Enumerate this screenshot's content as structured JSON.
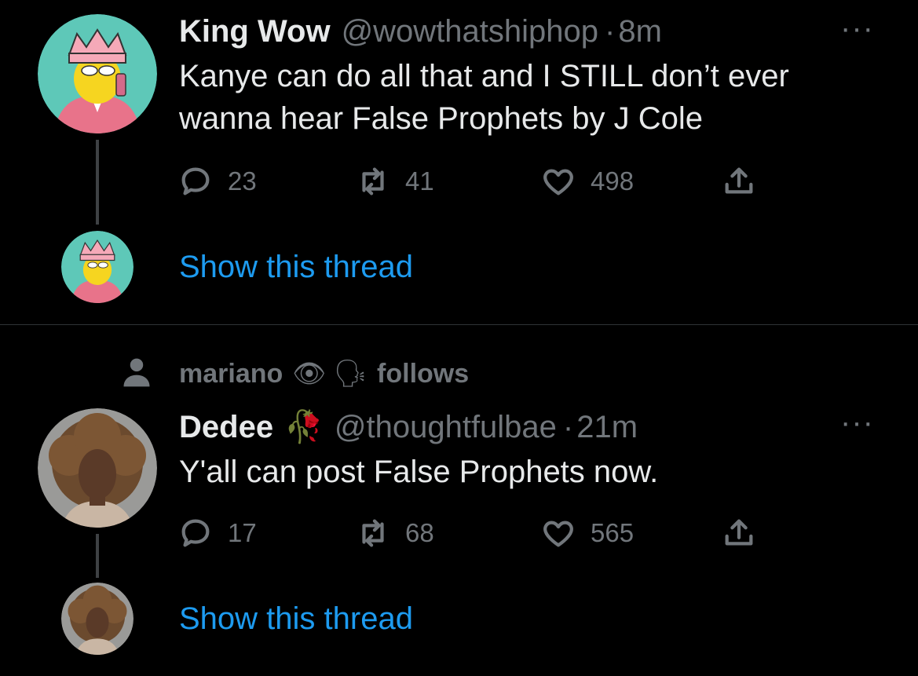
{
  "tweet1": {
    "display_name": "King Wow",
    "handle": "@wowthatshiphop",
    "separator": "·",
    "time": "8m",
    "more": "···",
    "text_line1": "Kanye can do all that and I STILL don’t ever",
    "text_line2": "wanna hear False Prophets by J Cole",
    "replies": "23",
    "retweets": "41",
    "likes": "498",
    "show_thread": "Show this thread"
  },
  "tweet2": {
    "social_context": "mariano",
    "social_context_emoji": "👁 🗣",
    "social_context_suffix": "follows",
    "display_name": "Dedee",
    "name_emoji": "🥀",
    "handle": "@thoughtfulbae",
    "separator": "·",
    "time": "21m",
    "more": "···",
    "text": "Y'all can post False Prophets now.",
    "replies": "17",
    "retweets": "68",
    "likes": "565",
    "show_thread": "Show this thread"
  },
  "colors": {
    "background": "#000000",
    "text_primary": "#e7e9ea",
    "text_secondary": "#71767b",
    "link": "#1d9bf0",
    "avatar1_bg": "#5ec8b8"
  },
  "icons": [
    "reply-icon",
    "retweet-icon",
    "like-icon",
    "share-icon",
    "person-icon"
  ]
}
